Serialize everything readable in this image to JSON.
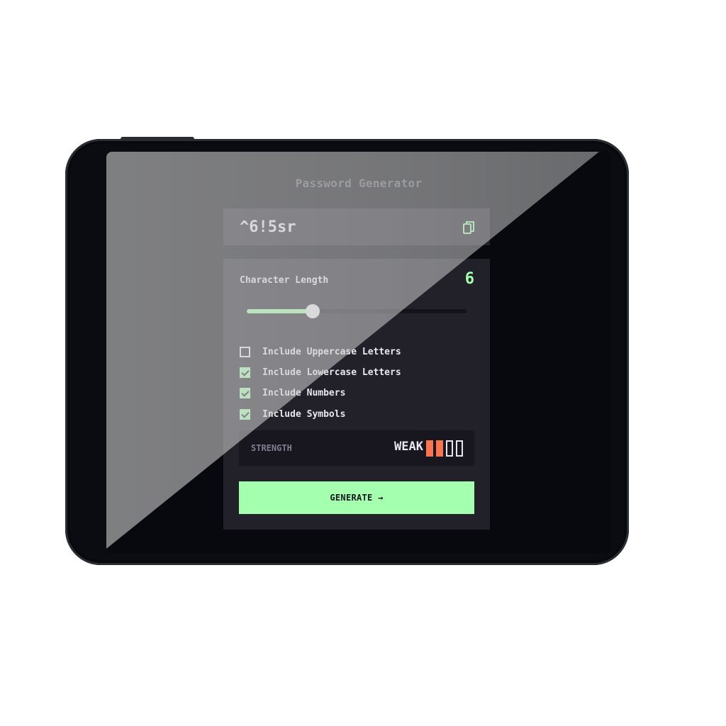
{
  "app": {
    "title": "Password Generator"
  },
  "password": {
    "value": "^6!5sr",
    "copy_icon": "copy-icon"
  },
  "length": {
    "label": "Character Length",
    "value": "6",
    "slider_fraction": 0.3
  },
  "options": [
    {
      "label": "Include Uppercase Letters",
      "checked": false
    },
    {
      "label": "Include Lowercase Letters",
      "checked": true
    },
    {
      "label": "Include Numbers",
      "checked": true
    },
    {
      "label": "Include Symbols",
      "checked": true
    }
  ],
  "strength": {
    "label": "STRENGTH",
    "level": "WEAK",
    "bars_filled": 2,
    "bars_total": 4
  },
  "generate": {
    "label": "GENERATE →"
  },
  "colors": {
    "accent": "#a4ffaf",
    "weak": "#f8754f",
    "panel": "#22212a",
    "background": "#08090e"
  }
}
